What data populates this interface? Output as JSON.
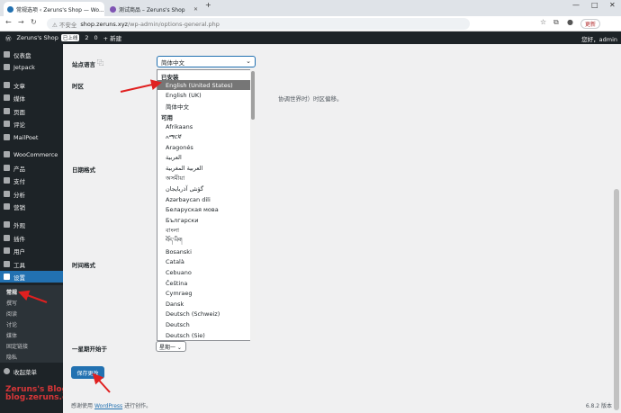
{
  "browser": {
    "tabs": [
      {
        "title": "常规选项 ‹ Zeruns's Shop — Wo..."
      },
      {
        "title": "测试商品 – Zeruns's Shop"
      }
    ],
    "new_tab": "+",
    "window_controls": [
      "—",
      "□",
      "✕"
    ],
    "address": {
      "warning": "⚠ 不安全",
      "host": "shop.zeruns.xyz",
      "path": "/wp-admin/options-general.php"
    },
    "update_label": "更新"
  },
  "adminbar": {
    "site": "Zeruns's Shop",
    "badge": "已上线",
    "updates": "2",
    "comments": "0",
    "new": "+ 新建",
    "greeting": "您好，admin"
  },
  "sidebar": {
    "items": [
      {
        "label": "仪表盘",
        "icon": "dashboard-icon"
      },
      {
        "label": "Jetpack",
        "icon": "jetpack-icon"
      },
      {
        "label": "文章",
        "icon": "pin-icon"
      },
      {
        "label": "媒体",
        "icon": "media-icon"
      },
      {
        "label": "页面",
        "icon": "page-icon"
      },
      {
        "label": "评论",
        "icon": "comment-icon"
      },
      {
        "label": "MailPoet",
        "icon": "mail-icon"
      },
      {
        "label": "WooCommerce",
        "icon": "woo-icon"
      },
      {
        "label": "产品",
        "icon": "product-icon"
      },
      {
        "label": "支付",
        "icon": "payment-icon"
      },
      {
        "label": "分析",
        "icon": "chart-icon"
      },
      {
        "label": "营销",
        "icon": "megaphone-icon"
      },
      {
        "label": "外观",
        "icon": "brush-icon"
      },
      {
        "label": "插件",
        "icon": "plugin-icon"
      },
      {
        "label": "用户",
        "icon": "user-icon"
      },
      {
        "label": "工具",
        "icon": "wrench-icon"
      },
      {
        "label": "设置",
        "icon": "settings-icon"
      }
    ],
    "submenu": [
      "常规",
      "撰写",
      "阅读",
      "讨论",
      "媒体",
      "固定链接",
      "隐私"
    ],
    "collapse": "收起菜单"
  },
  "watermark": {
    "line1": "Zeruns's Blog",
    "line2": "blog.zeruns.com"
  },
  "settings": {
    "site_language_label": "站点语言",
    "site_language_value": "简体中文",
    "timezone_label": "时区",
    "timezone_hint": "协调世界时）时区偏移。",
    "date_format_label": "日期格式",
    "time_format_label": "时间格式",
    "week_start_label": "一星期开始于",
    "week_start_value": "星期一 ⌄",
    "save_button": "保存更改"
  },
  "dropdown": {
    "installed_label": "已安装",
    "installed": [
      "English (United States)",
      "English (UK)",
      "简体中文"
    ],
    "available_label": "可用",
    "available": [
      "Afrikaans",
      "አማርኛ",
      "Aragonés",
      "العربية",
      "العربية المغربية",
      "অসমীয়া",
      "گؤنئی آذربایجان",
      "Azərbaycan dili",
      "Беларуская мова",
      "Български",
      "বাংলা",
      "བོད་ཡིག",
      "Bosanski",
      "Català",
      "Cebuano",
      "Čeština",
      "Cymraeg",
      "Dansk",
      "Deutsch (Schweiz)",
      "Deutsch",
      "Deutsch (Sie)"
    ]
  },
  "footer": {
    "prefix": "感谢使用",
    "link": "WordPress",
    "suffix": "进行创作。",
    "version": "6.8.2 版本"
  }
}
